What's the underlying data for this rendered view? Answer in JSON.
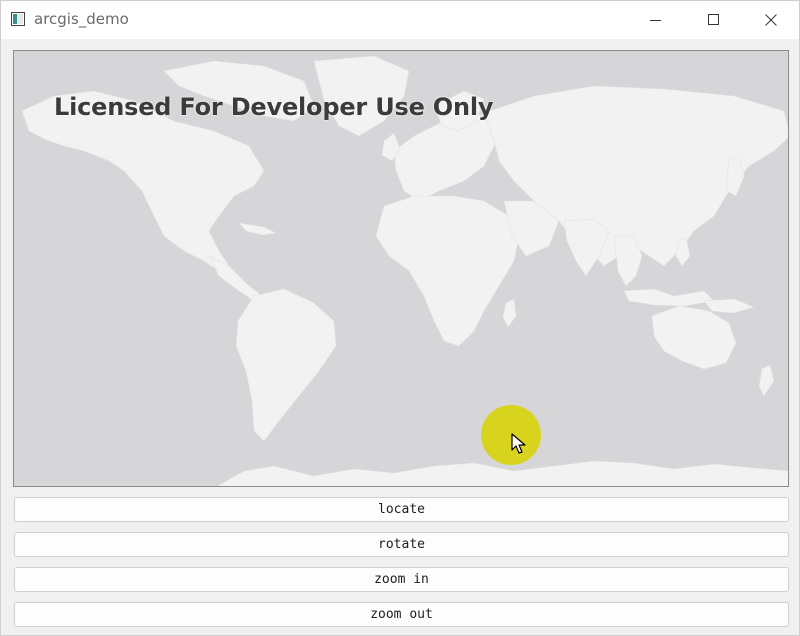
{
  "window": {
    "title": "arcgis_demo",
    "icon": "app-window-icon",
    "controls": {
      "minimize": "minimize-icon",
      "maximize": "maximize-icon",
      "close": "close-icon"
    }
  },
  "map": {
    "license_text": "Licensed For Developer Use Only",
    "ocean_color": "#d6d6d9",
    "land_color": "#f2f2f2",
    "highlight_color": "#d8d414"
  },
  "buttons": {
    "locate": "locate",
    "rotate": "rotate",
    "zoom_in": "zoom in",
    "zoom_out": "zoom out"
  }
}
